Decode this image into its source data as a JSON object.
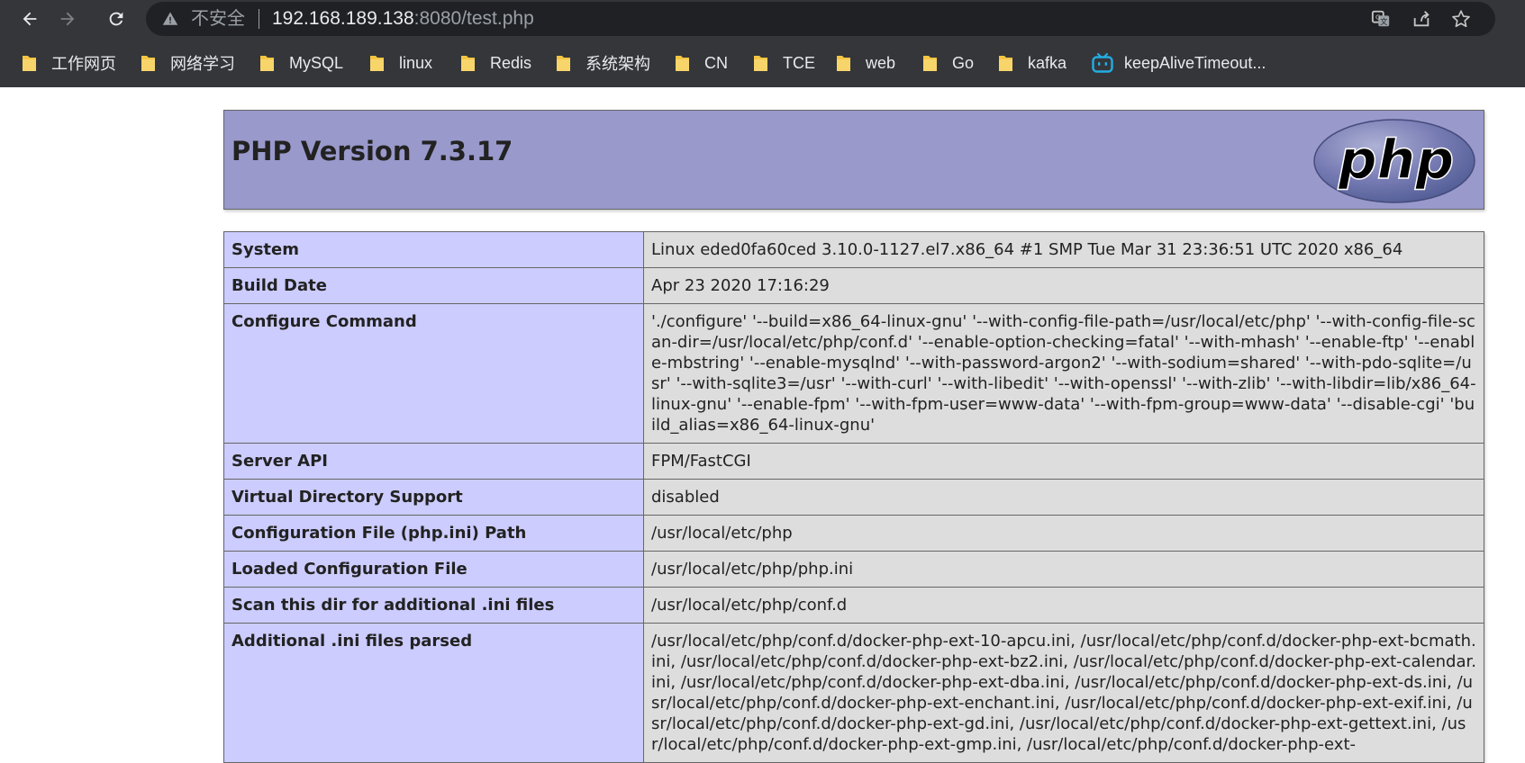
{
  "browser": {
    "insecure_label": "不安全",
    "url_host": "192.168.189.138",
    "url_rest": ":8080/test.php",
    "colors": {
      "chrome_bg": "#35363a",
      "omnibox_bg": "#202124",
      "folder": "#f5c542",
      "bilibili": "#23ade5"
    },
    "bookmarks": [
      {
        "label": "工作网页",
        "icon": "folder-icon"
      },
      {
        "label": "网络学习",
        "icon": "folder-icon"
      },
      {
        "label": "MySQL",
        "icon": "folder-icon"
      },
      {
        "label": "linux",
        "icon": "folder-icon"
      },
      {
        "label": "Redis",
        "icon": "folder-icon"
      },
      {
        "label": "系统架构",
        "icon": "folder-icon"
      },
      {
        "label": "CN",
        "icon": "folder-icon"
      },
      {
        "label": "TCE",
        "icon": "folder-icon"
      },
      {
        "label": "web",
        "icon": "folder-icon"
      },
      {
        "label": "Go",
        "icon": "folder-icon"
      },
      {
        "label": "kafka",
        "icon": "folder-icon"
      },
      {
        "label": "keepAliveTimeout...",
        "icon": "bilibili-tv-icon"
      }
    ]
  },
  "phpinfo": {
    "title": "PHP Version 7.3.17",
    "logo_text": "php",
    "colors": {
      "header": "#9999cc",
      "key_cell": "#ccccff",
      "value_cell": "#dddddd"
    },
    "rows": [
      {
        "key": "System",
        "value": "Linux eded0fa60ced 3.10.0-1127.el7.x86_64 #1 SMP Tue Mar 31 23:36:51 UTC 2020 x86_64"
      },
      {
        "key": "Build Date",
        "value": "Apr 23 2020 17:16:29"
      },
      {
        "key": "Configure Command",
        "value": "'./configure' '--build=x86_64-linux-gnu' '--with-config-file-path=/usr/local/etc/php' '--with-config-file-scan-dir=/usr/local/etc/php/conf.d' '--enable-option-checking=fatal' '--with-mhash' '--enable-ftp' '--enable-mbstring' '--enable-mysqlnd' '--with-password-argon2' '--with-sodium=shared' '--with-pdo-sqlite=/usr' '--with-sqlite3=/usr' '--with-curl' '--with-libedit' '--with-openssl' '--with-zlib' '--with-libdir=lib/x86_64-linux-gnu' '--enable-fpm' '--with-fpm-user=www-data' '--with-fpm-group=www-data' '--disable-cgi' 'build_alias=x86_64-linux-gnu'"
      },
      {
        "key": "Server API",
        "value": "FPM/FastCGI"
      },
      {
        "key": "Virtual Directory Support",
        "value": "disabled"
      },
      {
        "key": "Configuration File (php.ini) Path",
        "value": "/usr/local/etc/php"
      },
      {
        "key": "Loaded Configuration File",
        "value": "/usr/local/etc/php/php.ini"
      },
      {
        "key": "Scan this dir for additional .ini files",
        "value": "/usr/local/etc/php/conf.d"
      },
      {
        "key": "Additional .ini files parsed",
        "value": "/usr/local/etc/php/conf.d/docker-php-ext-10-apcu.ini, /usr/local/etc/php/conf.d/docker-php-ext-bcmath.ini, /usr/local/etc/php/conf.d/docker-php-ext-bz2.ini, /usr/local/etc/php/conf.d/docker-php-ext-calendar.ini, /usr/local/etc/php/conf.d/docker-php-ext-dba.ini, /usr/local/etc/php/conf.d/docker-php-ext-ds.ini, /usr/local/etc/php/conf.d/docker-php-ext-enchant.ini, /usr/local/etc/php/conf.d/docker-php-ext-exif.ini, /usr/local/etc/php/conf.d/docker-php-ext-gd.ini, /usr/local/etc/php/conf.d/docker-php-ext-gettext.ini, /usr/local/etc/php/conf.d/docker-php-ext-gmp.ini, /usr/local/etc/php/conf.d/docker-php-ext-"
      }
    ]
  }
}
